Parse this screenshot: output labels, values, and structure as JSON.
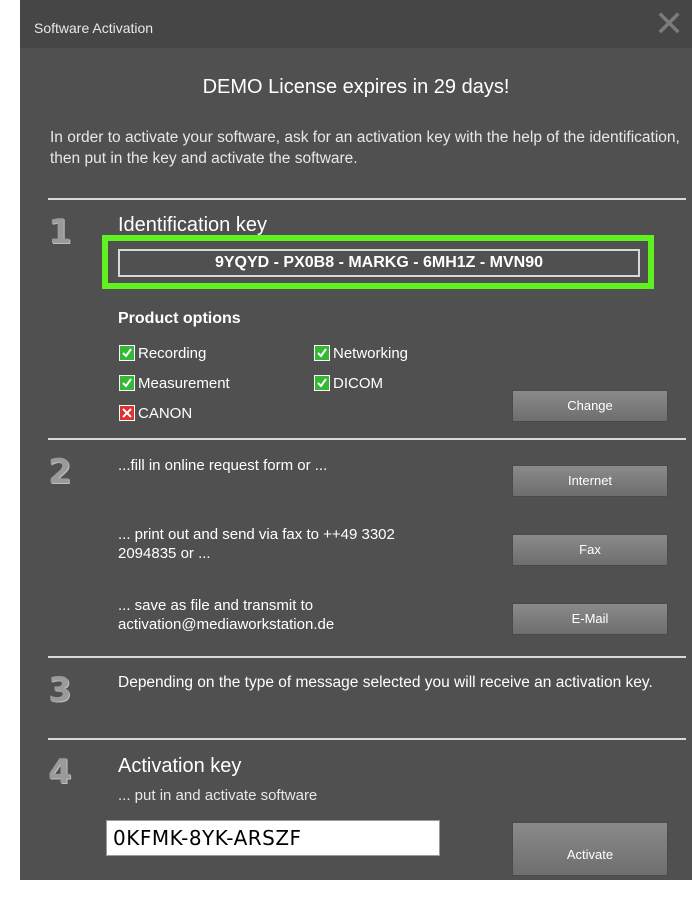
{
  "window": {
    "title": "Software Activation",
    "close_glyph": "✕"
  },
  "heading": "DEMO License expires in 29 days!",
  "intro": "In order to activate your software, ask for an activation key with the help of the identification, then put in the key and activate the software.",
  "step1": {
    "number": "1",
    "title": "Identification key",
    "id_key": "9YQYD - PX0B8 - MARKG - 6MH1Z - MVN90",
    "options_title": "Product options",
    "options": [
      {
        "label": "Recording",
        "checked": true
      },
      {
        "label": "Networking",
        "checked": true
      },
      {
        "label": "Measurement",
        "checked": true
      },
      {
        "label": "DICOM",
        "checked": true
      },
      {
        "label": "CANON",
        "checked": false
      }
    ],
    "change_button": "Change"
  },
  "step2": {
    "number": "2",
    "online_text": "...fill in online request form or ...",
    "internet_button": "Internet",
    "fax_text": "... print out and send via fax to ++49 3302 2094835 or ...",
    "fax_button": "Fax",
    "email_text": "... save as file and transmit to activation@mediaworkstation.de",
    "email_button": "E-Mail"
  },
  "step3": {
    "number": "3",
    "text": "Depending on the type of message selected you will receive an activation key."
  },
  "step4": {
    "number": "4",
    "title": "Activation key",
    "subtitle": "... put in and activate software",
    "activation_value": "0KFMK-8YK-ARSZF",
    "activate_button": "Activate"
  },
  "colors": {
    "window_bg": "#505050",
    "highlight_border": "#5ff21e",
    "check_on": "#35b835",
    "check_off": "#e03030"
  },
  "icons": [
    "close-icon",
    "checkbox-checked-icon",
    "checkbox-unchecked-icon"
  ]
}
